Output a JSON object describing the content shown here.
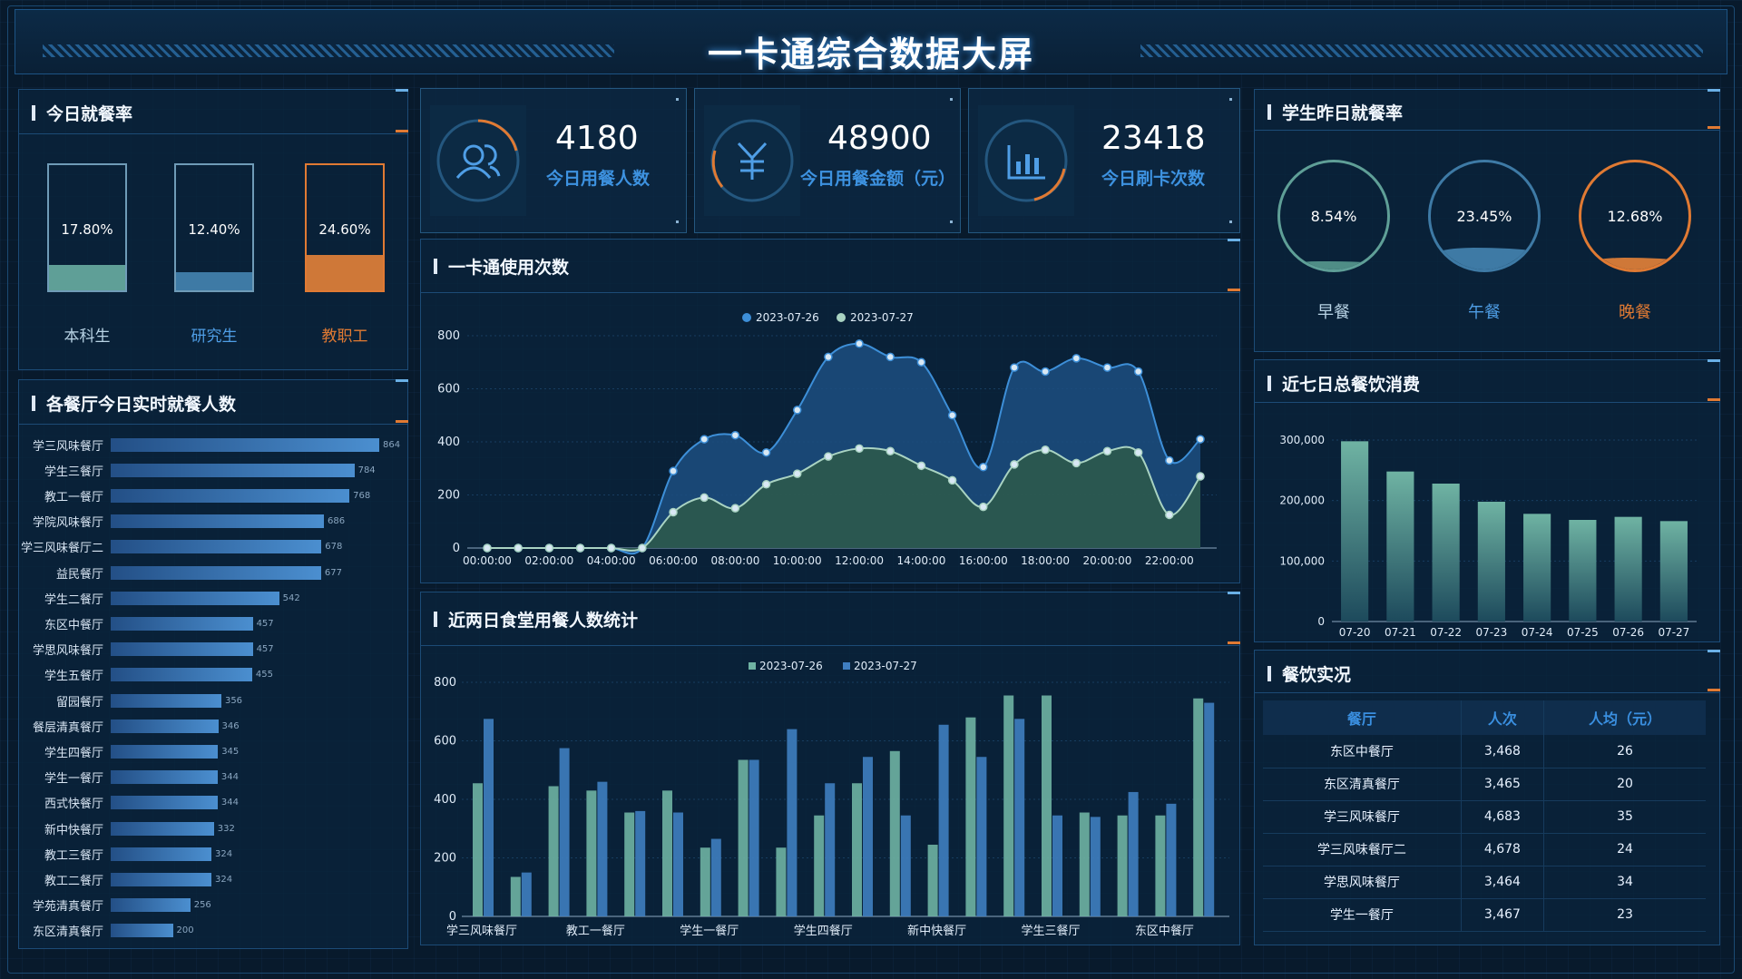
{
  "header": {
    "title": "一卡通综合数据大屏"
  },
  "dining_rate": {
    "title": "今日就餐率",
    "items": [
      {
        "label": "本科生",
        "pct_text": "17.80%",
        "value": 17.8,
        "color": "#5f9f97",
        "label_color": "#b9d4e6"
      },
      {
        "label": "研究生",
        "pct_text": "12.40%",
        "value": 12.4,
        "color": "#3e7aa5",
        "label_color": "#4f9ee6"
      },
      {
        "label": "教职工",
        "pct_text": "24.60%",
        "value": 24.6,
        "color": "#cf7838",
        "label_color": "#e07a33"
      }
    ]
  },
  "realtime": {
    "title": "各餐厅今日实时就餐人数",
    "max": 864,
    "rows": [
      {
        "name": "学三风味餐厅",
        "value": 864
      },
      {
        "name": "学生三餐厅",
        "value": 784
      },
      {
        "name": "教工一餐厅",
        "value": 768
      },
      {
        "name": "学院风味餐厅",
        "value": 686
      },
      {
        "name": "学三风味餐厅二",
        "value": 678
      },
      {
        "name": "益民餐厅",
        "value": 677
      },
      {
        "name": "学生二餐厅",
        "value": 542
      },
      {
        "name": "东区中餐厅",
        "value": 457
      },
      {
        "name": "学思风味餐厅",
        "value": 457
      },
      {
        "name": "学生五餐厅",
        "value": 455
      },
      {
        "name": "留园餐厅",
        "value": 356
      },
      {
        "name": "餐层清真餐厅",
        "value": 346
      },
      {
        "name": "学生四餐厅",
        "value": 345
      },
      {
        "name": "学生一餐厅",
        "value": 344
      },
      {
        "name": "西式快餐厅",
        "value": 344
      },
      {
        "name": "新中快餐厅",
        "value": 332
      },
      {
        "name": "教工三餐厅",
        "value": 324
      },
      {
        "name": "教工二餐厅",
        "value": 324
      },
      {
        "name": "学苑清真餐厅",
        "value": 256
      },
      {
        "name": "东区清真餐厅",
        "value": 200
      }
    ]
  },
  "stats": [
    {
      "value": "4180",
      "label": "今日用餐人数",
      "icon": "users-icon"
    },
    {
      "value": "48900",
      "label": "今日用餐金额（元）",
      "icon": "yuan-icon"
    },
    {
      "value": "23418",
      "label": "今日刷卡次数",
      "icon": "bar-chart-icon"
    }
  ],
  "usage": {
    "title": "一卡通使用次数",
    "chart_data": {
      "type": "area",
      "x": [
        "00:00:00",
        "01:00:00",
        "02:00:00",
        "03:00:00",
        "04:00:00",
        "05:00:00",
        "06:00:00",
        "07:00:00",
        "08:00:00",
        "09:00:00",
        "10:00:00",
        "11:00:00",
        "12:00:00",
        "13:00:00",
        "14:00:00",
        "15:00:00",
        "16:00:00",
        "17:00:00",
        "18:00:00",
        "19:00:00",
        "20:00:00",
        "21:00:00",
        "22:00:00",
        "23:00:00"
      ],
      "xticks": [
        "00:00:00",
        "02:00:00",
        "04:00:00",
        "06:00:00",
        "08:00:00",
        "10:00:00",
        "12:00:00",
        "14:00:00",
        "16:00:00",
        "18:00:00",
        "20:00:00",
        "22:00:00"
      ],
      "ylim": [
        0,
        800
      ],
      "yticks": [
        0,
        200,
        400,
        600,
        800
      ],
      "series": [
        {
          "name": "2023-07-26",
          "color": "#3d8fd8",
          "fill": "#1c4d80",
          "values": [
            0,
            0,
            0,
            0,
            0,
            0,
            290,
            410,
            425,
            360,
            520,
            720,
            770,
            720,
            700,
            500,
            305,
            680,
            665,
            715,
            680,
            665,
            330,
            410
          ]
        },
        {
          "name": "2023-07-27",
          "color": "#a9d3c2",
          "fill": "#2e5a4a",
          "values": [
            0,
            0,
            0,
            0,
            0,
            0,
            135,
            190,
            150,
            240,
            280,
            345,
            375,
            365,
            310,
            255,
            155,
            315,
            370,
            320,
            365,
            360,
            125,
            270
          ]
        }
      ]
    }
  },
  "canteen2d": {
    "title": "近两日食堂用餐人数统计",
    "chart_data": {
      "type": "bar",
      "xticks": [
        "学三风味餐厅",
        "教工一餐厅",
        "学生一餐厅",
        "学生四餐厅",
        "新中快餐厅",
        "学生三餐厅",
        "东区中餐厅"
      ],
      "ylim": [
        0,
        800
      ],
      "yticks": [
        0,
        200,
        400,
        600,
        800
      ],
      "series": [
        {
          "name": "2023-07-26",
          "color": "#6fb3a3",
          "values": [
            455,
            135,
            445,
            430,
            355,
            430,
            235,
            535,
            235,
            345,
            455,
            565,
            245,
            680,
            755,
            755,
            355,
            345,
            345,
            745
          ]
        },
        {
          "name": "2023-07-27",
          "color": "#3f7ec0",
          "values": [
            675,
            150,
            575,
            460,
            360,
            355,
            265,
            535,
            640,
            455,
            545,
            345,
            655,
            545,
            675,
            345,
            340,
            425,
            385,
            730
          ]
        }
      ]
    }
  },
  "yesterday": {
    "title": "学生昨日就餐率",
    "items": [
      {
        "label": "早餐",
        "pct_text": "8.54%",
        "value": 8.54,
        "ring": "#5f9f97",
        "fill": "#4f8d86",
        "label_color": "#b9d4e6"
      },
      {
        "label": "午餐",
        "pct_text": "23.45%",
        "value": 23.45,
        "ring": "#3e7aa5",
        "fill": "#3e7aa5",
        "label_color": "#4f9ee6"
      },
      {
        "label": "晚餐",
        "pct_text": "12.68%",
        "value": 12.68,
        "ring": "#e07a33",
        "fill": "#cf7838",
        "label_color": "#e07a33"
      }
    ]
  },
  "weekly": {
    "title": "近七日总餐饮消费",
    "chart_data": {
      "type": "bar",
      "categories": [
        "07-20",
        "07-21",
        "07-22",
        "07-23",
        "07-24",
        "07-25",
        "07-26",
        "07-27"
      ],
      "values": [
        298000,
        248000,
        228000,
        198000,
        178000,
        168000,
        173000,
        166000
      ],
      "ylim": [
        0,
        300000
      ],
      "yticks": [
        "0",
        "100,000",
        "200,000",
        "300,000"
      ],
      "color": "#6fb3a3"
    }
  },
  "realtable": {
    "title": "餐饮实况",
    "headers": [
      "餐厅",
      "人次",
      "人均（元）"
    ],
    "rows": [
      [
        "东区中餐厅",
        "3,468",
        "26"
      ],
      [
        "东区清真餐厅",
        "3,465",
        "20"
      ],
      [
        "学三风味餐厅",
        "4,683",
        "35"
      ],
      [
        "学三风味餐厅二",
        "4,678",
        "24"
      ],
      [
        "学思风味餐厅",
        "3,464",
        "34"
      ],
      [
        "学生一餐厅",
        "3,467",
        "23"
      ]
    ]
  }
}
